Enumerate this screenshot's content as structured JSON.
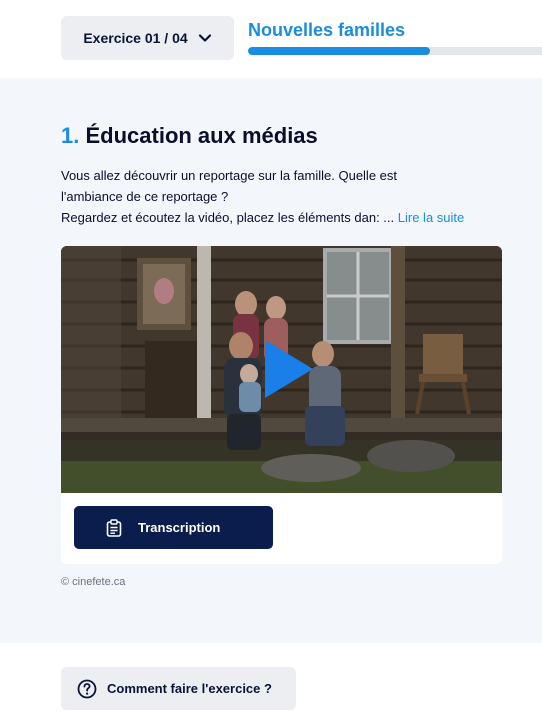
{
  "header": {
    "exercise_selector": "Exercice 01 / 04",
    "lesson_title": "Nouvelles familles",
    "progress": 0.62
  },
  "section": {
    "number": "1.",
    "title": "Éducation aux médias",
    "instructions": {
      "line1": "Vous allez découvrir un reportage sur la famille. Quelle est",
      "line2": "l'ambiance de ce reportage ?",
      "line3": "Regardez et écoutez la vidéo, placez les éléments dan: ...",
      "read_more": "Lire la suite"
    }
  },
  "video": {
    "transcript_label": "Transcription",
    "credit": "© cinefete.ca"
  },
  "help": {
    "label": "Comment faire l'exercice ?"
  },
  "colors": {
    "accent": "#1a8de0",
    "navy": "#0b1d4d",
    "section_bg": "#f3f6fb",
    "button_grey": "#eceef1"
  },
  "icons": {
    "selector": "chevron-down-icon",
    "play": "play-icon",
    "transcript": "clipboard-icon",
    "help": "question-circle-icon"
  }
}
